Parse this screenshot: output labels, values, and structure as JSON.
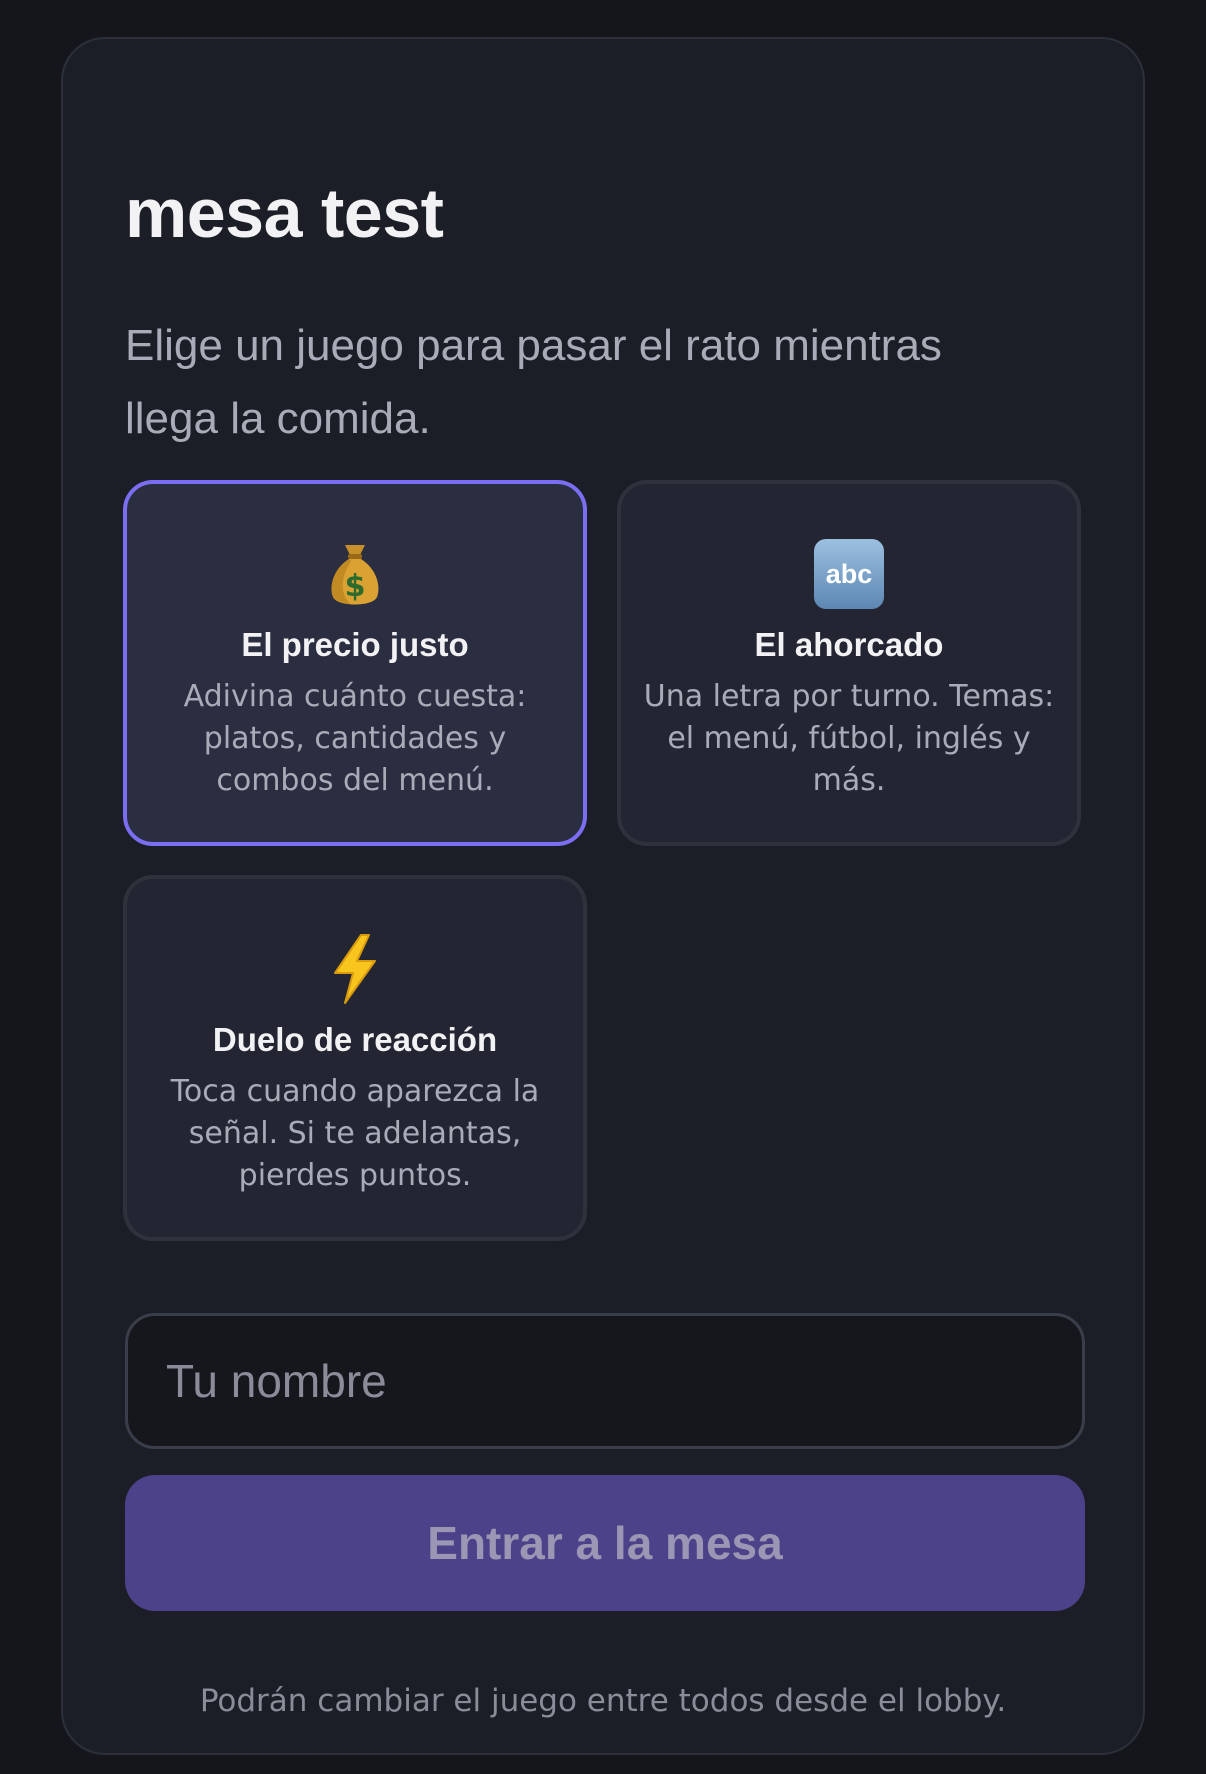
{
  "table": {
    "title": "mesa test",
    "subtitle": "Elige un juego para pasar el rato mientras llega la comida."
  },
  "games": [
    {
      "icon": "money-bag-icon",
      "name": "El precio justo",
      "description": "Adivina cuánto cuesta: platos, cantidades y combos del menú.",
      "selected": true
    },
    {
      "icon": "abc-icon",
      "name": "El ahorcado",
      "description": "Una letra por turno. Temas: el menú, fútbol, inglés y más.",
      "selected": false
    },
    {
      "icon": "lightning-icon",
      "name": "Duelo de reacción",
      "description": "Toca cuando aparezca la señal. Si te adelantas, pierdes puntos.",
      "selected": false
    }
  ],
  "form": {
    "name_placeholder": "Tu nombre",
    "name_value": "",
    "submit_label": "Entrar a la mesa"
  },
  "footnote": "Podrán cambiar el juego entre todos desde el lobby.",
  "colors": {
    "background": "#14161b",
    "card": "#1b1e26",
    "accent": "#7c6ef2",
    "button": "#4b428a"
  }
}
